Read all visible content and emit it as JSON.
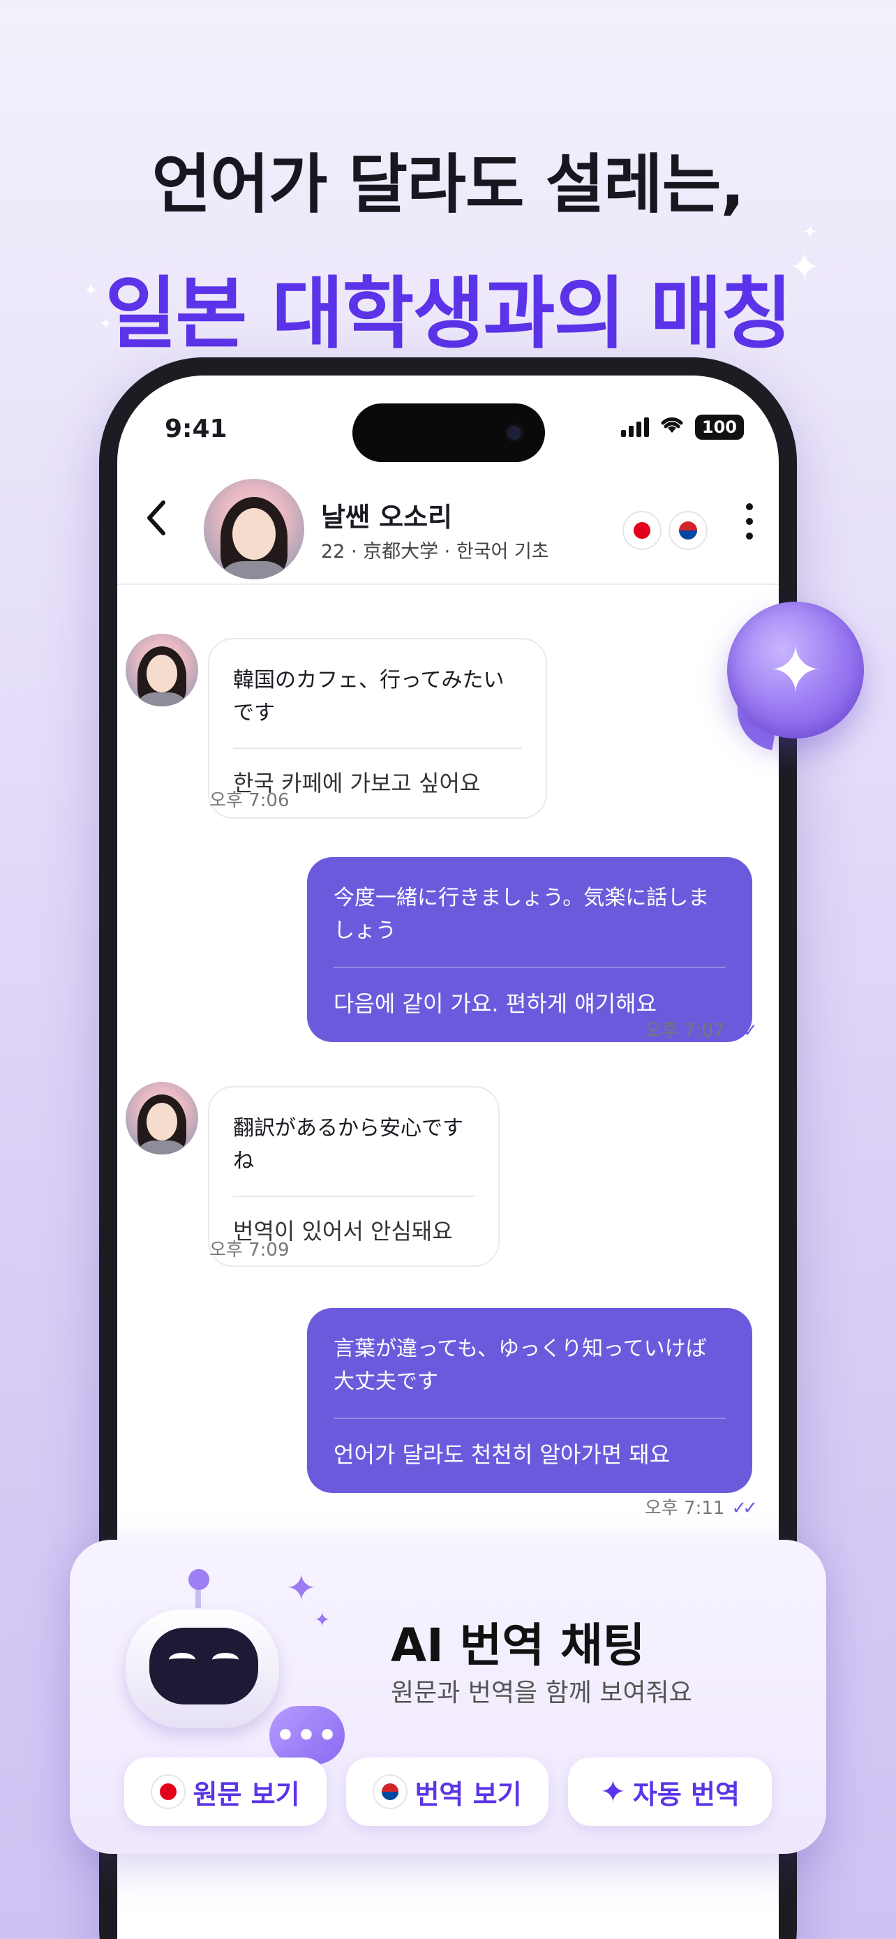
{
  "headline": {
    "line1": "언어가 달라도 설레는,",
    "line2": "일본 대학생과의 매칭"
  },
  "status_bar": {
    "time": "9:41",
    "battery": "100"
  },
  "chat_header": {
    "back_icon": "chevron-left-icon",
    "name": "날쌘 오소리",
    "subtitle": "22 · 京都大学 · 한국어 기초",
    "flags": [
      "japan-flag-icon",
      "korea-flag-icon"
    ],
    "more_icon": "more-vertical-icon"
  },
  "messages": [
    {
      "direction": "in",
      "original": "韓国のカフェ、行ってみたいです",
      "translation": "한국 카페에 가보고 싶어요",
      "time": "오후 7:06"
    },
    {
      "direction": "out",
      "original": "今度一緒に行きましょう。気楽に話しましょう",
      "translation": "다음에 같이 가요. 편하게 얘기해요",
      "time": "오후 7:07",
      "read": true
    },
    {
      "direction": "in",
      "original": "翻訳があるから安心ですね",
      "translation": "번역이 있어서 안심돼요",
      "time": "오후 7:09"
    },
    {
      "direction": "out",
      "original": "言葉が違っても、ゆっくり知っていけば大丈夫です",
      "translation": "언어가 달라도 천천히 알아가면 돼요",
      "time": "오후 7:11",
      "read": true
    }
  ],
  "read_mark": "✓✓",
  "fab_icon": "sparkle-icon",
  "feature_card": {
    "title": "AI 번역 채팅",
    "description": "원문과 번역을 함께 보여줘요",
    "robot_bubble": "•••",
    "buttons": [
      {
        "label": "원문 보기",
        "icon": "japan-flag-icon"
      },
      {
        "label": "번역 보기",
        "icon": "korea-flag-icon"
      },
      {
        "label": "자동 번역",
        "icon": "sparkle-icon"
      }
    ]
  },
  "colors": {
    "accent": "#5b33e8",
    "outgoing_bubble": "#6b5bdc",
    "background_top": "#f3f0fb",
    "background_bottom": "#cfc2f3"
  }
}
